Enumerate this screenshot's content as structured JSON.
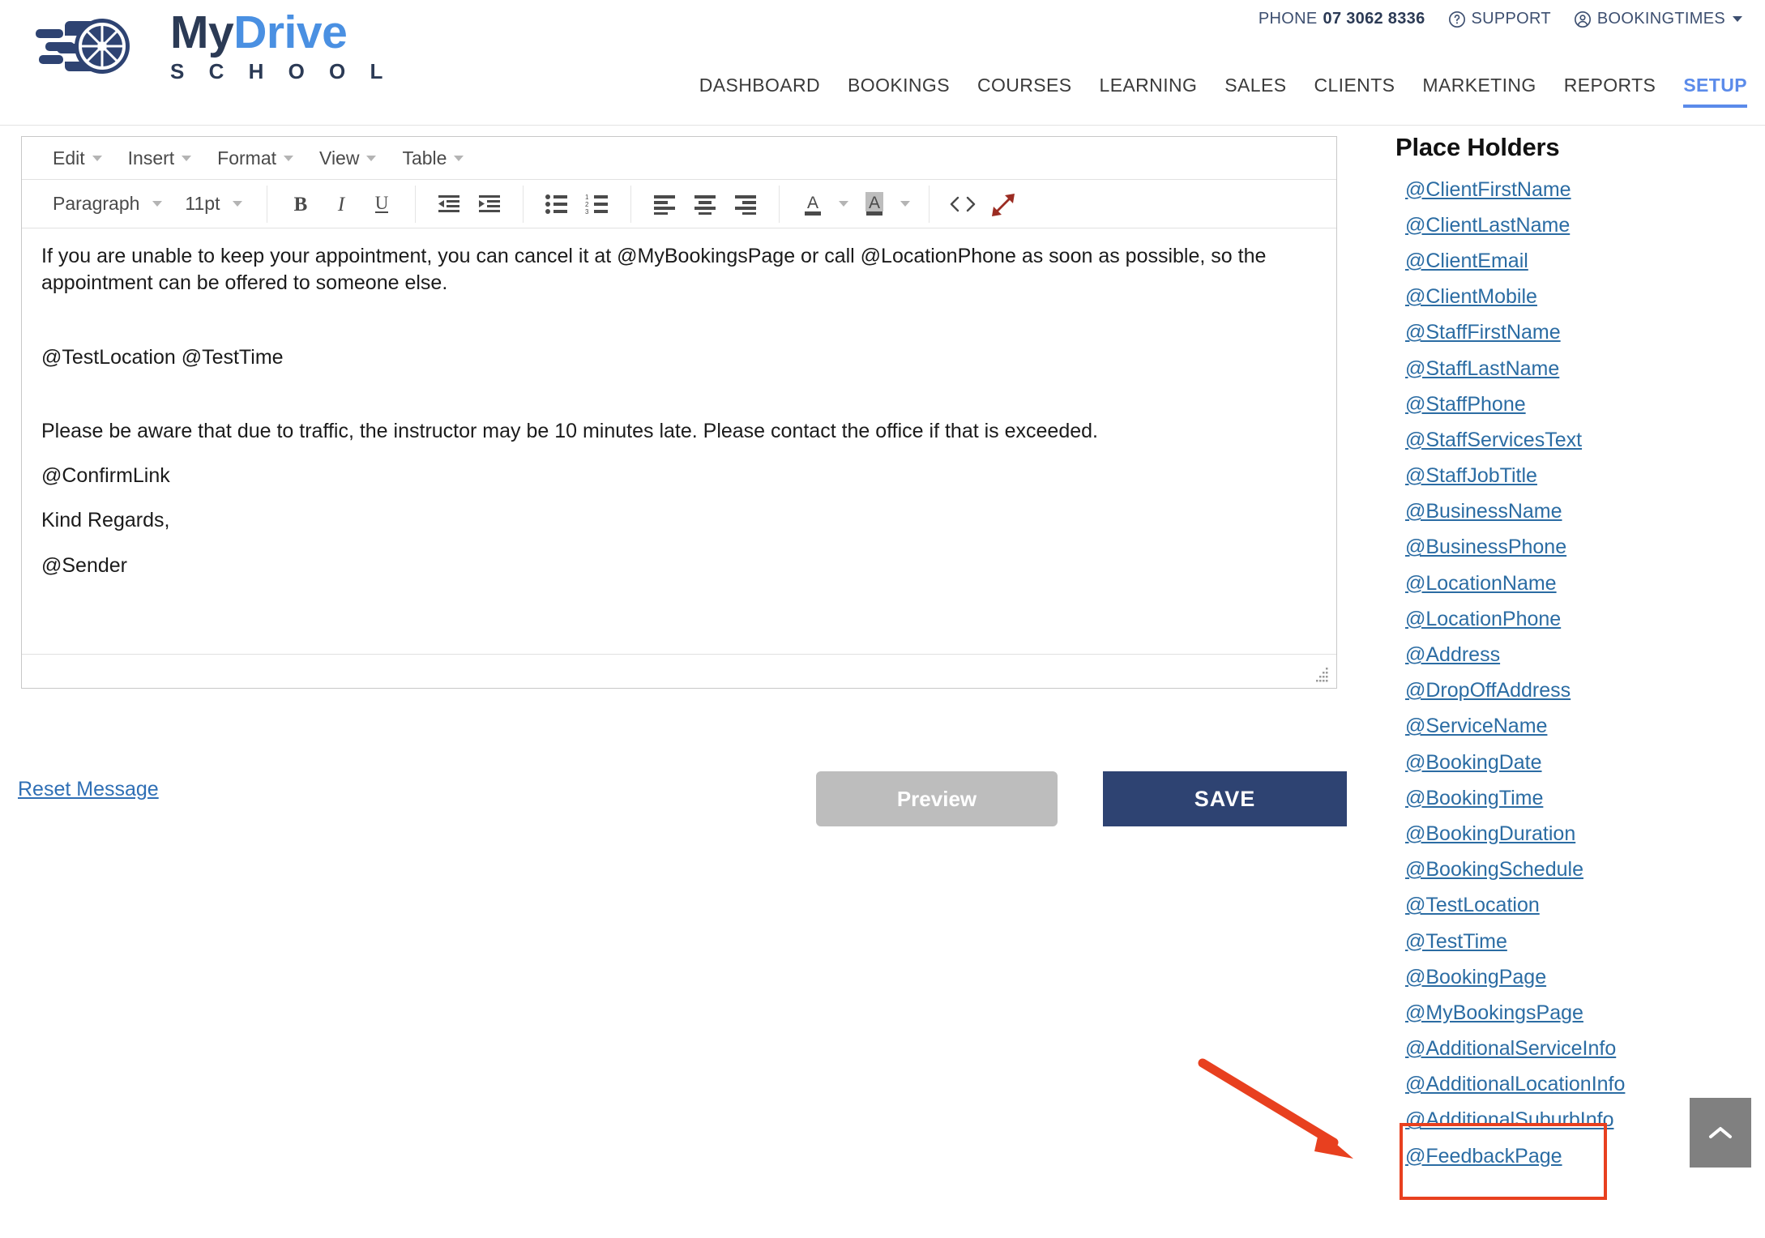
{
  "header": {
    "logo": {
      "brand_part1": "My",
      "brand_part2": "Drive",
      "subtitle": "S C H O O L",
      "color_dark": "#2b3a55",
      "color_blue": "#4a90e2",
      "icon": "wheel-speed-icon"
    },
    "utility": {
      "phone_label": "PHONE",
      "phone_number": "07 3062 8336",
      "support_label": "SUPPORT",
      "support_icon": "question-circle-icon",
      "account_label": "BOOKINGTIMES",
      "account_icon": "user-circle-icon",
      "account_caret": "chevron-down-icon"
    },
    "nav": {
      "items": [
        {
          "label": "DASHBOARD",
          "active": false
        },
        {
          "label": "BOOKINGS",
          "active": false
        },
        {
          "label": "COURSES",
          "active": false
        },
        {
          "label": "LEARNING",
          "active": false
        },
        {
          "label": "SALES",
          "active": false
        },
        {
          "label": "CLIENTS",
          "active": false
        },
        {
          "label": "MARKETING",
          "active": false
        },
        {
          "label": "REPORTS",
          "active": false
        },
        {
          "label": "SETUP",
          "active": true
        }
      ],
      "active_color": "#5b8bea"
    }
  },
  "editor": {
    "menus": [
      {
        "label": "Edit"
      },
      {
        "label": "Insert"
      },
      {
        "label": "Format"
      },
      {
        "label": "View"
      },
      {
        "label": "Table"
      }
    ],
    "toolbar": {
      "block_format": "Paragraph",
      "font_size": "11pt",
      "buttons": [
        {
          "name": "bold-icon",
          "label": "B"
        },
        {
          "name": "italic-icon",
          "label": "I"
        },
        {
          "name": "underline-icon",
          "label": "U"
        },
        {
          "name": "outdent-icon",
          "label": ""
        },
        {
          "name": "indent-icon",
          "label": ""
        },
        {
          "name": "bullet-list-icon",
          "label": ""
        },
        {
          "name": "numbered-list-icon",
          "label": ""
        },
        {
          "name": "align-left-icon",
          "label": ""
        },
        {
          "name": "align-center-icon",
          "label": ""
        },
        {
          "name": "align-right-icon",
          "label": ""
        },
        {
          "name": "text-color-icon",
          "label": "A"
        },
        {
          "name": "background-color-icon",
          "label": "A"
        },
        {
          "name": "source-code-icon",
          "label": "<>"
        },
        {
          "name": "fullscreen-icon",
          "label": ""
        }
      ],
      "fullscreen_color": "#9b2c22"
    },
    "content": {
      "para1": "If you are unable to keep your appointment, you can cancel it at @MyBookingsPage or call @LocationPhone as soon as possible, so the appointment can be offered to someone else.",
      "para2": "@TestLocation @TestTime",
      "para3": "Please be aware that due to traffic, the instructor may be 10 minutes late. Please contact the office if that is exceeded.",
      "para4": "@ConfirmLink",
      "para5": "Kind Regards,",
      "para6": "@Sender"
    },
    "resize_handle": "resize-grip-icon"
  },
  "actions": {
    "reset_label": "Reset Message",
    "preview_label": "Preview",
    "save_label": "SAVE",
    "preview_color": "#bdbdbd",
    "save_color": "#2e4372"
  },
  "placeholders": {
    "title": "Place Holders",
    "link_color": "#2b6ca3",
    "items": [
      "@ClientFirstName",
      "@ClientLastName",
      "@ClientEmail",
      "@ClientMobile",
      "@StaffFirstName",
      "@StaffLastName",
      "@StaffPhone",
      "@StaffServicesText",
      "@StaffJobTitle",
      "@BusinessName",
      "@BusinessPhone",
      "@LocationName",
      "@LocationPhone",
      "@Address",
      "@DropOffAddress",
      "@ServiceName",
      "@BookingDate",
      "@BookingTime",
      "@BookingDuration",
      "@BookingSchedule",
      "@TestLocation",
      "@TestTime",
      "@BookingPage",
      "@MyBookingsPage",
      "@AdditionalServiceInfo",
      "@AdditionalLocationInfo",
      "@AdditionalSuburbInfo",
      "@FeedbackPage"
    ]
  },
  "annotations": {
    "highlight_color": "#e8401f",
    "highlight_targets": [
      "@AdditionalLocationInfo",
      "@AdditionalSuburbInfo"
    ],
    "arrow_icon": "red-arrow-icon"
  },
  "scroll_top": {
    "icon": "chevron-up-icon",
    "color": "#808080"
  }
}
